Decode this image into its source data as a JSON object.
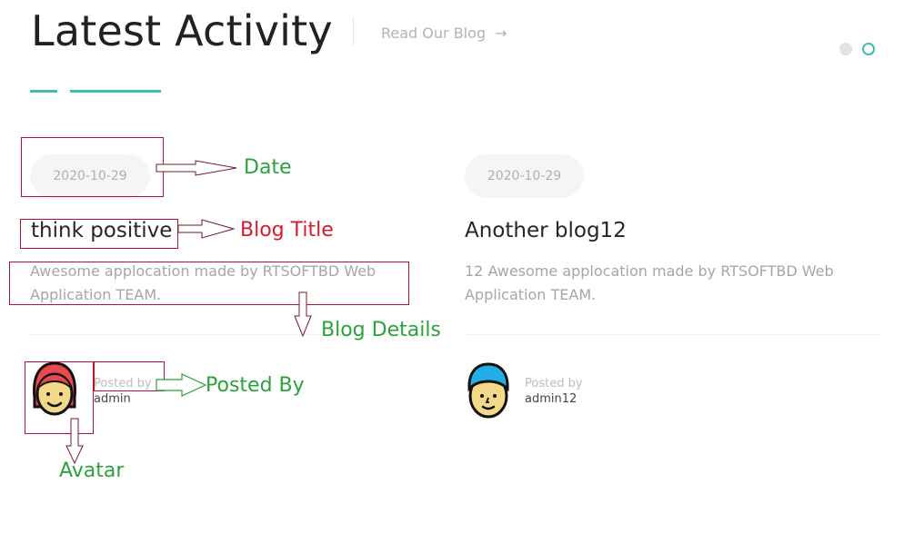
{
  "header": {
    "title": "Latest Activity",
    "blog_link_label": "Read Our Blog",
    "blog_link_arrow": "→"
  },
  "carousel": {
    "dots": [
      {
        "active": false
      },
      {
        "active": true
      }
    ]
  },
  "colors": {
    "accent": "#3fbcb4",
    "pill_bg": "#f4f5f4",
    "annotation_border": "#b3142b",
    "annotation_green": "#2ba23c",
    "annotation_red": "#d81b2c"
  },
  "posts": [
    {
      "date": "2020-10-29",
      "title": "think positive",
      "details": "Awesome applocation made by RTSOFTBD Web Application TEAM.",
      "posted_by_label": "Posted by",
      "author": "admin",
      "avatar_icon": "female-avatar-icon",
      "avatar_hair_color": "#e84a4f"
    },
    {
      "date": "2020-10-29",
      "title": "Another blog12",
      "details": "12 Awesome applocation made by RTSOFTBD Web Application TEAM.",
      "posted_by_label": "Posted by",
      "author": "admin12",
      "avatar_icon": "male-avatar-icon",
      "avatar_hair_color": "#24aee8"
    }
  ],
  "annotations": {
    "date": "Date",
    "blog_title": "Blog Title",
    "blog_details": "Blog Details",
    "posted_by": "Posted By",
    "avatar": "Avatar"
  }
}
